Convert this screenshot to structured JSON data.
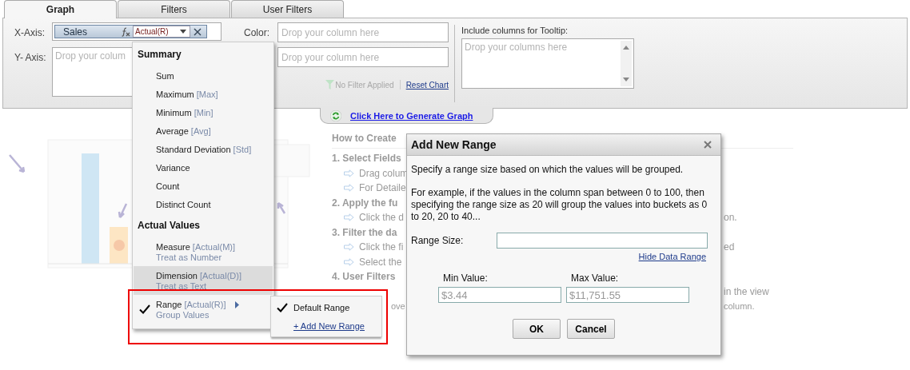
{
  "tabs": [
    {
      "label": "Graph",
      "selected": true
    },
    {
      "label": "Filters",
      "selected": false
    },
    {
      "label": "User Filters",
      "selected": false
    }
  ],
  "axes": {
    "x_label": "X-Axis:",
    "x_chip": {
      "name": "Sales",
      "aggregation": "Actual(R)"
    },
    "y_label": "Y- Axis:",
    "y_placeholder": "Drop your colum"
  },
  "color": {
    "label": "Color:",
    "placeholder": "Drop your column here"
  },
  "second_field": {
    "placeholder": "Drop your column here"
  },
  "filter_status": {
    "text": "No Filter Applied",
    "disabled": true
  },
  "reset_link": "Reset Chart",
  "tooltip": {
    "label": "Include columns for Tooltip:",
    "placeholder": "Drop your columns here"
  },
  "generate_link": "Click Here to Generate Graph",
  "help": [
    {
      "kind": "title",
      "text": "How to Create"
    },
    {
      "kind": "heading",
      "text": "1. Select Fields"
    },
    {
      "kind": "bullet",
      "text": "Drag colum"
    },
    {
      "kind": "bullet",
      "text": "For Detaile"
    },
    {
      "kind": "heading",
      "text": "2. Apply the fu"
    },
    {
      "kind": "bullet",
      "text": "Click the d",
      "tail": "on."
    },
    {
      "kind": "heading",
      "text": "3. Filter the da"
    },
    {
      "kind": "bullet",
      "text": "Click the fi",
      "tail": "ed"
    },
    {
      "kind": "bullet",
      "text": "Select the"
    },
    {
      "kind": "heading",
      "text": "4. User Filters"
    },
    {
      "kind": "plain",
      "tail": "in the view"
    },
    {
      "kind": "wrap",
      "text": "ove",
      "tail": "column."
    }
  ],
  "menu": {
    "sections": [
      {
        "heading": "Summary",
        "items": [
          {
            "label": "Sum",
            "checked": false,
            "highlighted": false,
            "has_submenu": false
          },
          {
            "label": "Maximum",
            "tag": "[Max]",
            "checked": false,
            "highlighted": false,
            "has_submenu": false
          },
          {
            "label": "Minimum",
            "tag": "[Min]",
            "checked": false,
            "highlighted": false,
            "has_submenu": false
          },
          {
            "label": "Average",
            "tag": "[Avg]",
            "checked": false,
            "highlighted": false,
            "has_submenu": false
          },
          {
            "label": "Standard Deviation",
            "tag": "[Std]",
            "checked": false,
            "highlighted": false,
            "has_submenu": false
          },
          {
            "label": "Variance",
            "checked": false,
            "highlighted": false,
            "has_submenu": false
          },
          {
            "label": "Count",
            "checked": false,
            "highlighted": false,
            "has_submenu": false
          },
          {
            "label": "Distinct Count",
            "checked": false,
            "highlighted": false,
            "has_submenu": false
          }
        ]
      },
      {
        "heading": "Actual Values",
        "items": [
          {
            "label": "Measure",
            "tag": "[Actual(M)]",
            "note": "Treat as Number",
            "checked": false,
            "highlighted": false,
            "has_submenu": false
          },
          {
            "label": "Dimension",
            "tag": "[Actual(D)]",
            "note": "Treat as Text",
            "checked": false,
            "highlighted": true,
            "has_submenu": false
          },
          {
            "label": "Range",
            "tag": "[Actual(R)]",
            "note": "Group Values",
            "checked": true,
            "highlighted": false,
            "has_submenu": true
          }
        ]
      }
    ]
  },
  "submenu": {
    "items": [
      {
        "kind": "option",
        "label": "Default Range",
        "checked": true
      },
      {
        "kind": "link",
        "label": "+ Add New Range",
        "checked": false
      }
    ]
  },
  "dialog": {
    "title": "Add New Range",
    "paragraphs": [
      "Specify a range size based on which the values will be grouped.",
      "For example, if the values in the column span between 0 to 100, then specifying the range size as 20 will group the values into buckets as 0 to 20, 20 to 40..."
    ],
    "range_label": "Range Size:",
    "hide_link": "Hide Data Range",
    "min_label": "Min Value:",
    "min_value": "$3.44",
    "max_label": "Max Value:",
    "max_value": "$11,751.55",
    "values_disabled": true,
    "buttons": [
      "OK",
      "Cancel"
    ]
  }
}
